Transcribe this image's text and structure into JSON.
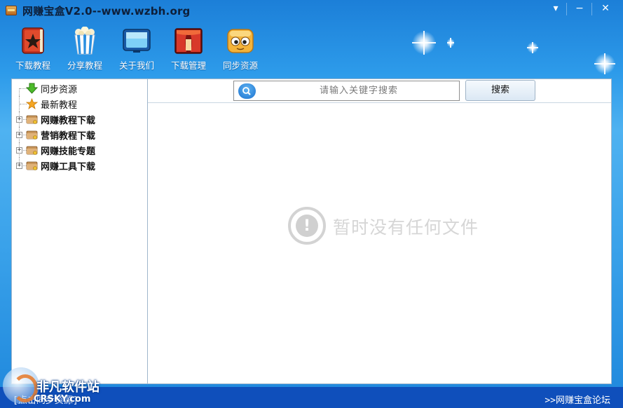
{
  "window": {
    "title": "网赚宝盒V2.0--www.wzbh.org",
    "controls": {
      "menu": "▾",
      "minimize": "−",
      "close": "✕"
    }
  },
  "toolbar": {
    "items": [
      {
        "label": "下载教程",
        "icon": "book-star-icon"
      },
      {
        "label": "分享教程",
        "icon": "popcorn-icon"
      },
      {
        "label": "关于我们",
        "icon": "monitor-icon"
      },
      {
        "label": "下载管理",
        "icon": "stage-curtain-icon"
      },
      {
        "label": "同步资源",
        "icon": "cartoon-face-icon"
      }
    ]
  },
  "tree": {
    "items": [
      {
        "label": "同步资源",
        "icon": "green-down-arrow-icon",
        "expandable": false,
        "bold": false
      },
      {
        "label": "最新教程",
        "icon": "star-icon",
        "expandable": false,
        "bold": false
      },
      {
        "label": "网赚教程下载",
        "icon": "folder-icon",
        "expandable": true,
        "bold": true
      },
      {
        "label": "营销教程下载",
        "icon": "folder-icon",
        "expandable": true,
        "bold": true
      },
      {
        "label": "网赚技能专题",
        "icon": "folder-icon",
        "expandable": true,
        "bold": true
      },
      {
        "label": "网赚工具下载",
        "icon": "folder-icon",
        "expandable": true,
        "bold": true
      }
    ],
    "expander_symbol": "+"
  },
  "search": {
    "placeholder": "请输入关键字搜索",
    "button_label": "搜索"
  },
  "content": {
    "empty_message": "暂时没有任何文件",
    "empty_icon_glyph": "!"
  },
  "status": {
    "left_text": "[点击同步资源]",
    "forum_link": ">>网赚宝盒论坛"
  },
  "watermark": {
    "cn": "非凡软件站",
    "en": "CRSKY.com"
  },
  "colors": {
    "titlebar_gradient_top": "#1c7fd8",
    "status_bar": "#0f4fbb",
    "panel_border": "#9fb6cc",
    "empty_text": "#d6d6d6"
  }
}
